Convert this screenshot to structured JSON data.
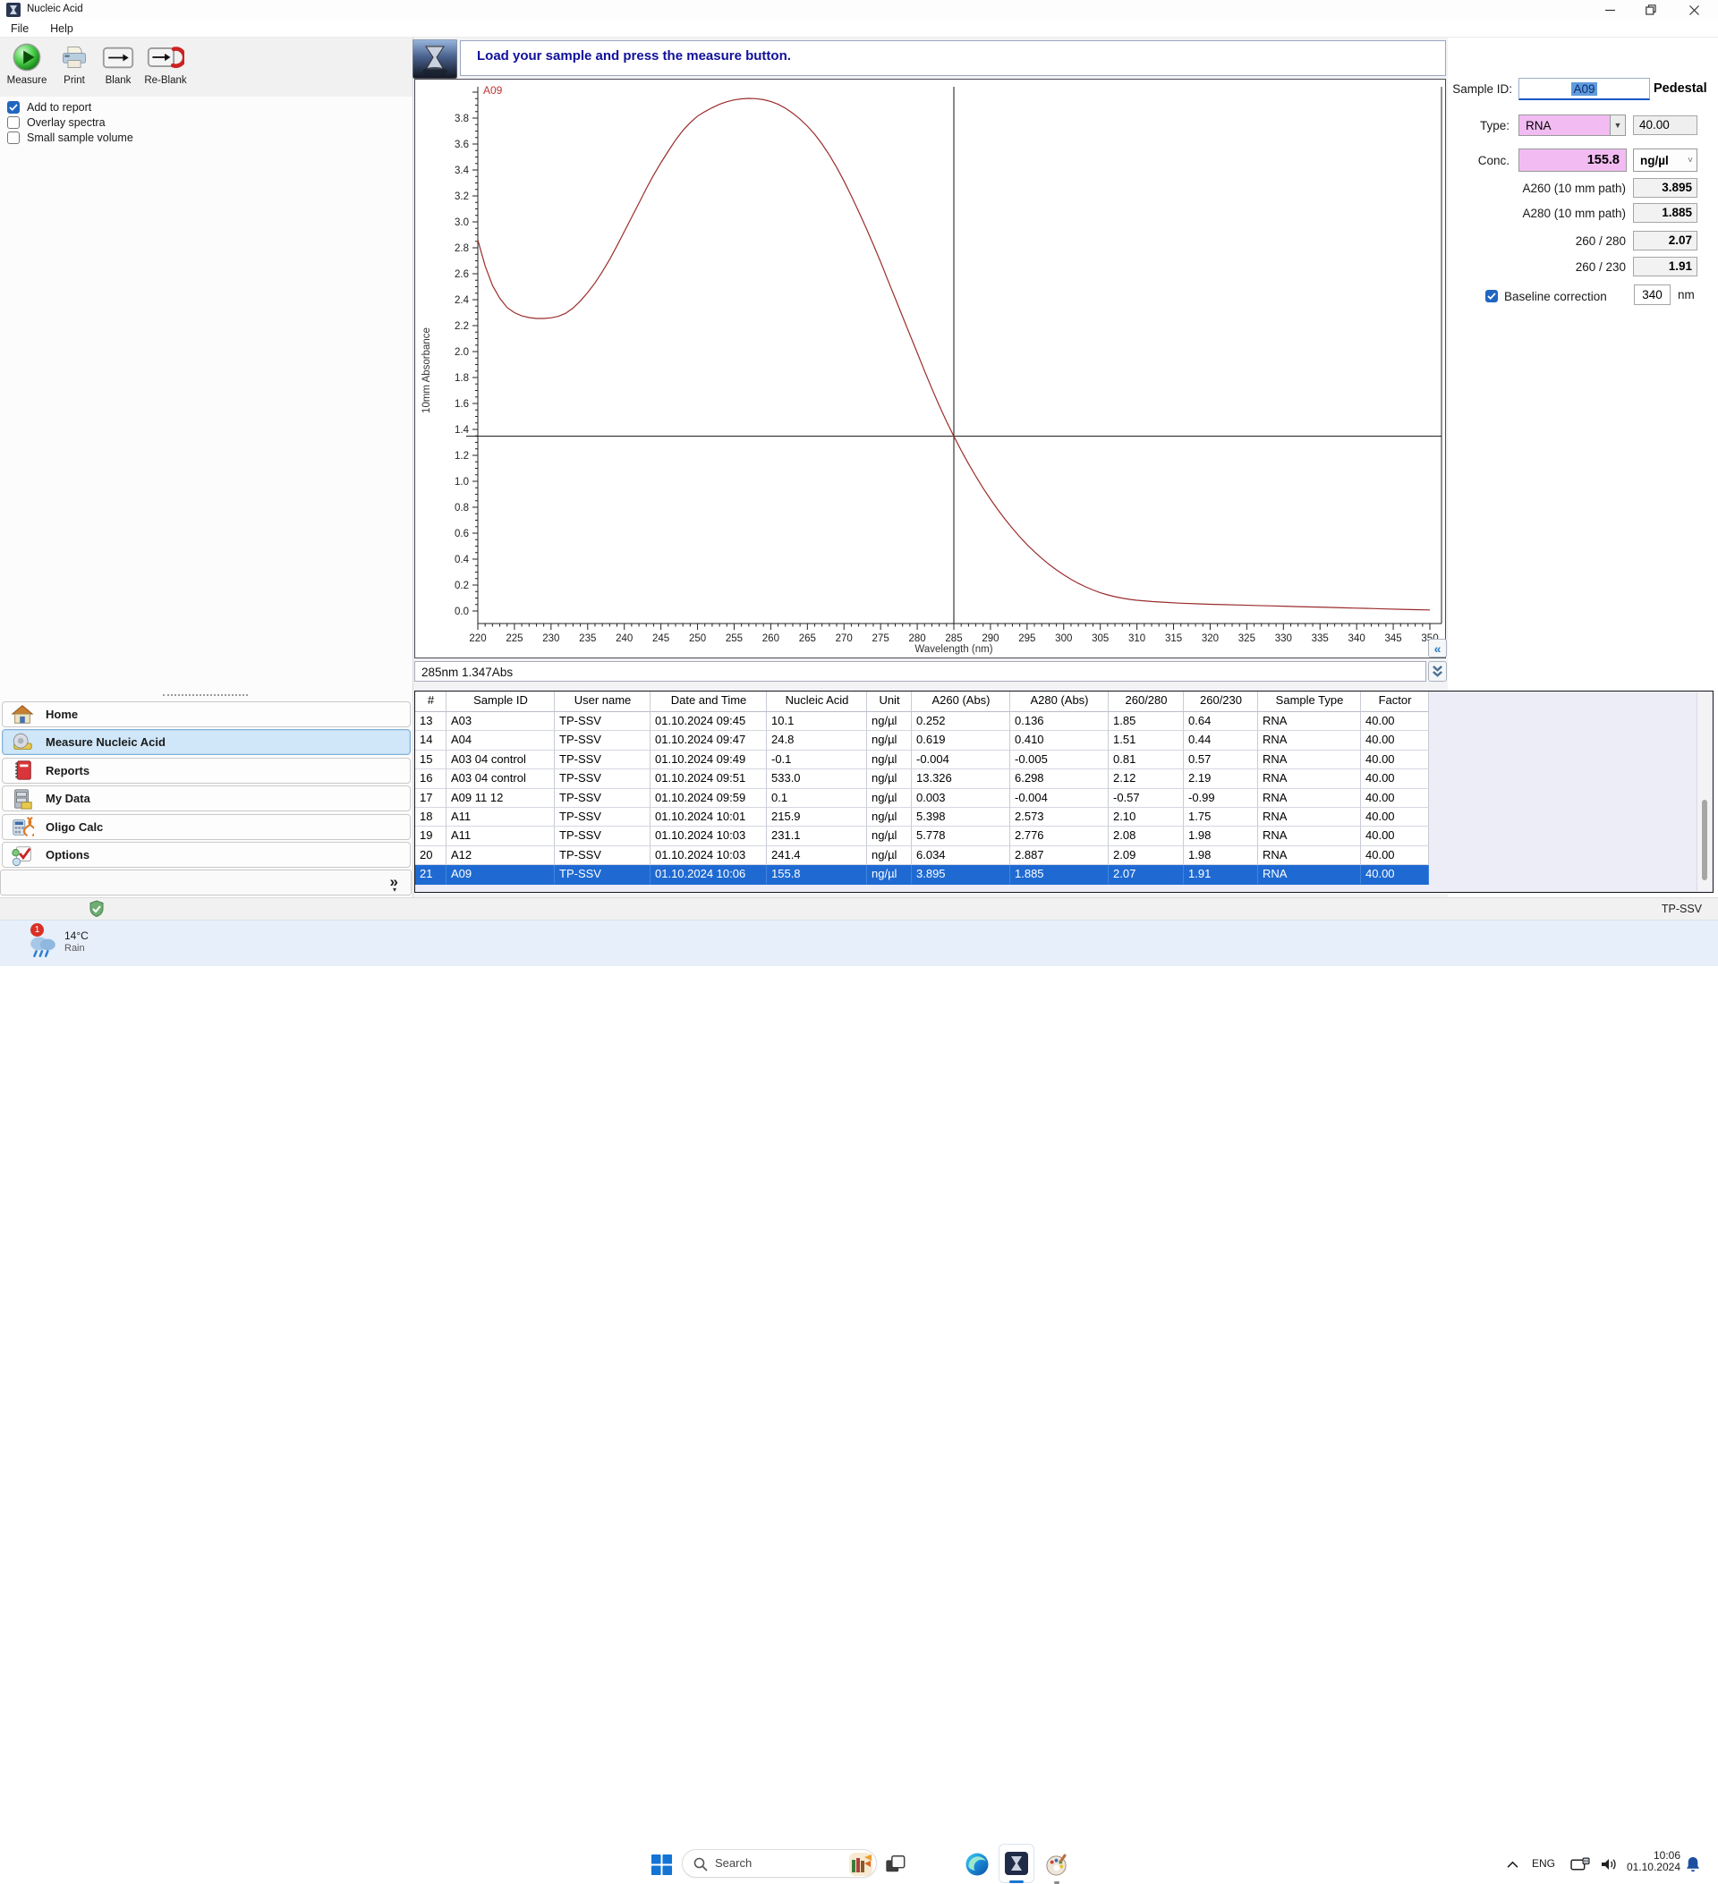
{
  "window": {
    "title": "Nucleic Acid"
  },
  "menu": {
    "items": [
      "File",
      "Help"
    ]
  },
  "toolbar": {
    "buttons": [
      {
        "label": "Measure",
        "icon": "measure-icon"
      },
      {
        "label": "Print",
        "icon": "print-icon"
      },
      {
        "label": "Blank",
        "icon": "blank-icon"
      },
      {
        "label": "Re-Blank",
        "icon": "reblank-icon"
      }
    ]
  },
  "checkboxes": [
    {
      "label": "Add to report",
      "checked": true
    },
    {
      "label": "Overlay spectra",
      "checked": false
    },
    {
      "label": "Small sample volume",
      "checked": false
    }
  ],
  "nav": {
    "items": [
      {
        "label": "Home",
        "icon": "home-icon",
        "selected": false
      },
      {
        "label": "Measure Nucleic Acid",
        "icon": "measure-nav-icon",
        "selected": true
      },
      {
        "label": "Reports",
        "icon": "reports-icon",
        "selected": false
      },
      {
        "label": "My Data",
        "icon": "mydata-icon",
        "selected": false
      },
      {
        "label": "Oligo Calc",
        "icon": "oligo-calc-icon",
        "selected": false
      },
      {
        "label": "Options",
        "icon": "options-icon",
        "selected": false
      }
    ],
    "expander": "»"
  },
  "main": {
    "instruction": "Load your sample and press the measure button.",
    "status_readout": "285nm 1.347Abs"
  },
  "side_panel": {
    "sample_id_label": "Sample ID:",
    "sample_id_value": "A09",
    "mode_label": "Pedestal",
    "type_label": "Type:",
    "type_value": "RNA",
    "factor_value": "40.00",
    "conc_label": "Conc.",
    "conc_value": "155.8",
    "conc_unit": "ng/µl",
    "metrics": [
      {
        "label": "A260 (10 mm path)",
        "value": "3.895"
      },
      {
        "label": "A280 (10 mm path)",
        "value": "1.885"
      },
      {
        "label": "260 / 280",
        "value": "2.07"
      },
      {
        "label": "260 / 230",
        "value": "1.91"
      }
    ],
    "baseline": {
      "label": "Baseline correction",
      "checked": true,
      "value": "340",
      "unit": "nm"
    },
    "accent_pink": "#f2bcf2",
    "accent_blue": "#2166c0"
  },
  "chart_data": {
    "type": "line",
    "xlabel": "Wavelength (nm)",
    "ylabel": "10mm Absorbance",
    "xlim": [
      220,
      350
    ],
    "ylim": [
      -0.1,
      4.05
    ],
    "x_tick_step": 5,
    "x_minor_step": 1,
    "y_tick_step": 0.2,
    "y_minor_step": 0.05,
    "y_label_max": 3.8,
    "grid": false,
    "curve_label": "A09",
    "series": [
      {
        "name": "A09",
        "color": "#9b2c2c",
        "points": [
          [
            220,
            2.86
          ],
          [
            221,
            2.66
          ],
          [
            222,
            2.51
          ],
          [
            223,
            2.41
          ],
          [
            224,
            2.34
          ],
          [
            225,
            2.3
          ],
          [
            226,
            2.275
          ],
          [
            227,
            2.262
          ],
          [
            228,
            2.255
          ],
          [
            229,
            2.255
          ],
          [
            230,
            2.26
          ],
          [
            231,
            2.272
          ],
          [
            232,
            2.295
          ],
          [
            233,
            2.335
          ],
          [
            234,
            2.39
          ],
          [
            235,
            2.455
          ],
          [
            236,
            2.53
          ],
          [
            237,
            2.615
          ],
          [
            238,
            2.71
          ],
          [
            239,
            2.815
          ],
          [
            240,
            2.925
          ],
          [
            241,
            3.035
          ],
          [
            242,
            3.145
          ],
          [
            243,
            3.255
          ],
          [
            244,
            3.36
          ],
          [
            245,
            3.455
          ],
          [
            246,
            3.545
          ],
          [
            247,
            3.63
          ],
          [
            248,
            3.705
          ],
          [
            249,
            3.765
          ],
          [
            250,
            3.815
          ],
          [
            251,
            3.85
          ],
          [
            252,
            3.88
          ],
          [
            253,
            3.906
          ],
          [
            254,
            3.926
          ],
          [
            255,
            3.94
          ],
          [
            256,
            3.948
          ],
          [
            257,
            3.952
          ],
          [
            258,
            3.95
          ],
          [
            259,
            3.942
          ],
          [
            260,
            3.928
          ],
          [
            261,
            3.906
          ],
          [
            262,
            3.876
          ],
          [
            263,
            3.838
          ],
          [
            264,
            3.792
          ],
          [
            265,
            3.738
          ],
          [
            266,
            3.675
          ],
          [
            267,
            3.6
          ],
          [
            268,
            3.515
          ],
          [
            269,
            3.42
          ],
          [
            270,
            3.315
          ],
          [
            271,
            3.2
          ],
          [
            272,
            3.08
          ],
          [
            273,
            2.955
          ],
          [
            274,
            2.825
          ],
          [
            275,
            2.69
          ],
          [
            276,
            2.55
          ],
          [
            277,
            2.41
          ],
          [
            278,
            2.27
          ],
          [
            279,
            2.13
          ],
          [
            280,
            1.99
          ],
          [
            281,
            1.85
          ],
          [
            282,
            1.715
          ],
          [
            283,
            1.585
          ],
          [
            284,
            1.462
          ],
          [
            285,
            1.347
          ],
          [
            286,
            1.238
          ],
          [
            287,
            1.135
          ],
          [
            288,
            1.038
          ],
          [
            289,
            0.947
          ],
          [
            290,
            0.862
          ],
          [
            291,
            0.782
          ],
          [
            292,
            0.707
          ],
          [
            293,
            0.637
          ],
          [
            294,
            0.572
          ],
          [
            295,
            0.512
          ],
          [
            296,
            0.457
          ],
          [
            297,
            0.406
          ],
          [
            298,
            0.359
          ],
          [
            299,
            0.317
          ],
          [
            300,
            0.279
          ],
          [
            301,
            0.244
          ],
          [
            302,
            0.213
          ],
          [
            303,
            0.186
          ],
          [
            304,
            0.162
          ],
          [
            305,
            0.141
          ],
          [
            306,
            0.124
          ],
          [
            307,
            0.11
          ],
          [
            308,
            0.099
          ],
          [
            309,
            0.09
          ],
          [
            310,
            0.083
          ],
          [
            312,
            0.073
          ],
          [
            314,
            0.066
          ],
          [
            316,
            0.06
          ],
          [
            318,
            0.056
          ],
          [
            320,
            0.052
          ],
          [
            322,
            0.049
          ],
          [
            324,
            0.046
          ],
          [
            326,
            0.043
          ],
          [
            328,
            0.04
          ],
          [
            330,
            0.037
          ],
          [
            332,
            0.034
          ],
          [
            334,
            0.031
          ],
          [
            336,
            0.028
          ],
          [
            338,
            0.025
          ],
          [
            340,
            0.022
          ],
          [
            342,
            0.019
          ],
          [
            344,
            0.016
          ],
          [
            346,
            0.013
          ],
          [
            348,
            0.01
          ],
          [
            350,
            0.008
          ]
        ]
      }
    ],
    "crosshair": {
      "x": 285,
      "y": 1.347
    }
  },
  "results_table": {
    "headers": [
      "#",
      "Sample ID",
      "User name",
      "Date and Time",
      "Nucleic Acid",
      "Unit",
      "A260 (Abs)",
      "A280 (Abs)",
      "260/280",
      "260/230",
      "Sample Type",
      "Factor"
    ],
    "rows": [
      [
        "13",
        "A03",
        "TP-SSV",
        "01.10.2024 09:45",
        "10.1",
        "ng/µl",
        "0.252",
        "0.136",
        "1.85",
        "0.64",
        "RNA",
        "40.00"
      ],
      [
        "14",
        "A04",
        "TP-SSV",
        "01.10.2024 09:47",
        "24.8",
        "ng/µl",
        "0.619",
        "0.410",
        "1.51",
        "0.44",
        "RNA",
        "40.00"
      ],
      [
        "15",
        "A03 04 control",
        "TP-SSV",
        "01.10.2024 09:49",
        "-0.1",
        "ng/µl",
        "-0.004",
        "-0.005",
        "0.81",
        "0.57",
        "RNA",
        "40.00"
      ],
      [
        "16",
        "A03 04 control",
        "TP-SSV",
        "01.10.2024 09:51",
        "533.0",
        "ng/µl",
        "13.326",
        "6.298",
        "2.12",
        "2.19",
        "RNA",
        "40.00"
      ],
      [
        "17",
        "A09 11 12",
        "TP-SSV",
        "01.10.2024 09:59",
        "0.1",
        "ng/µl",
        "0.003",
        "-0.004",
        "-0.57",
        "-0.99",
        "RNA",
        "40.00"
      ],
      [
        "18",
        "A11",
        "TP-SSV",
        "01.10.2024 10:01",
        "215.9",
        "ng/µl",
        "5.398",
        "2.573",
        "2.10",
        "1.75",
        "RNA",
        "40.00"
      ],
      [
        "19",
        "A11",
        "TP-SSV",
        "01.10.2024 10:03",
        "231.1",
        "ng/µl",
        "5.778",
        "2.776",
        "2.08",
        "1.98",
        "RNA",
        "40.00"
      ],
      [
        "20",
        "A12",
        "TP-SSV",
        "01.10.2024 10:03",
        "241.4",
        "ng/µl",
        "6.034",
        "2.887",
        "2.09",
        "1.98",
        "RNA",
        "40.00"
      ],
      [
        "21",
        "A09",
        "TP-SSV",
        "01.10.2024 10:06",
        "155.8",
        "ng/µl",
        "3.895",
        "1.885",
        "2.07",
        "1.91",
        "RNA",
        "40.00"
      ]
    ],
    "selected_row_index": 8,
    "selection_color": "#1f6ad2"
  },
  "app_status": {
    "user": "TP-SSV"
  },
  "taskbar": {
    "weather": {
      "temp": "14°C",
      "condition": "Rain",
      "badge": "1"
    },
    "search_placeholder": "Search",
    "tray": {
      "language": "ENG",
      "time": "10:06",
      "date": "01.10.2024"
    }
  }
}
